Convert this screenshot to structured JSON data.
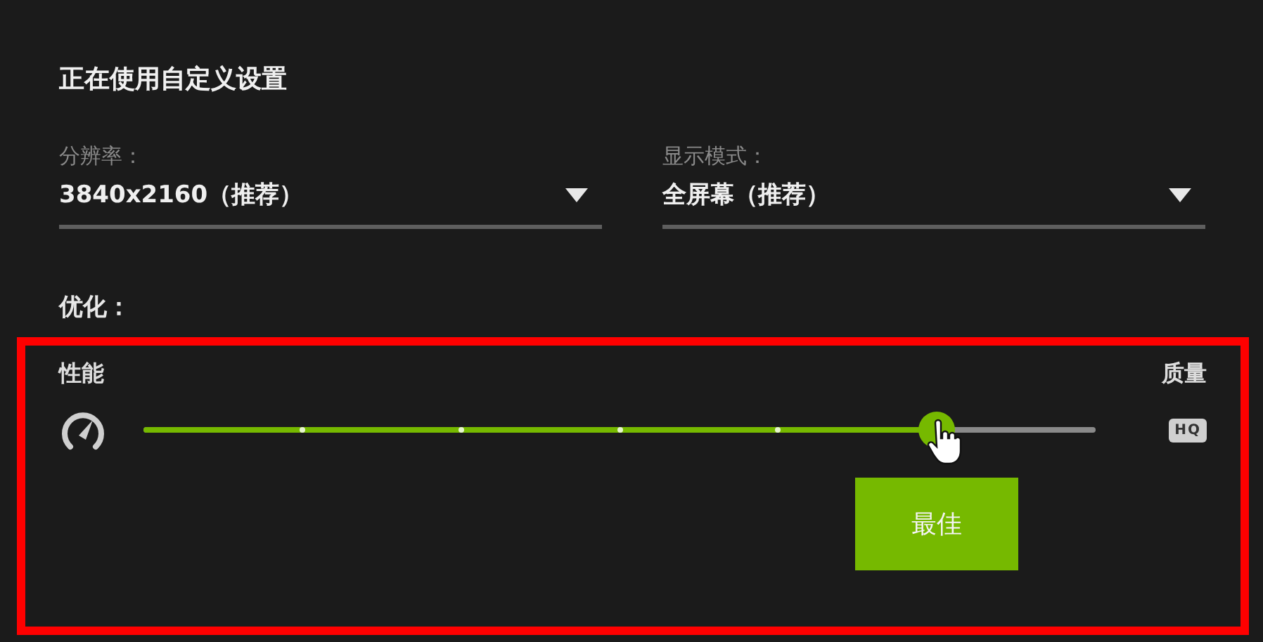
{
  "title": "正在使用自定义设置",
  "dropdowns": [
    {
      "label": "分辨率：",
      "value": "3840x2160（推荐）"
    },
    {
      "label": "显示模式：",
      "value": "全屏幕（推荐）"
    }
  ],
  "optimization": {
    "label": "优化：",
    "left_label": "性能",
    "right_label": "质量",
    "hq_badge": "HQ",
    "level": 0.833,
    "tooltip": "最佳"
  }
}
